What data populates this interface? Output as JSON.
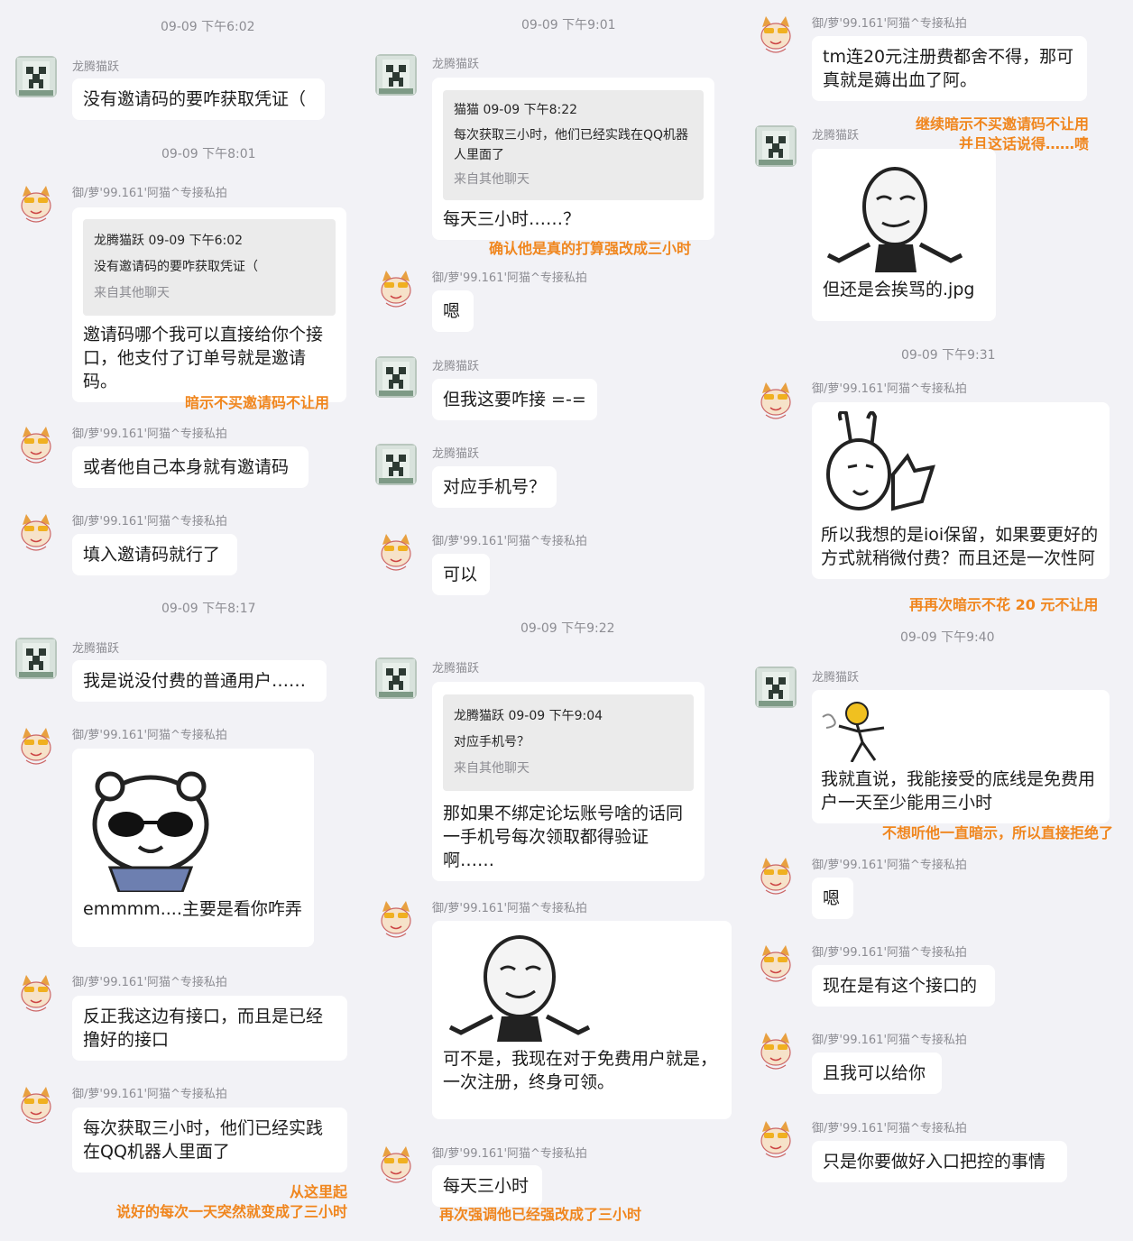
{
  "names": {
    "a": "龙腾猫跃",
    "b": "御/萝'99.161'阿猫^专接私拍"
  },
  "quote_source": "来自其他聊天",
  "col1": {
    "ts1": "09-09 下午6:02",
    "m1": "没有邀请码的要咋获取凭证（",
    "ts2": "09-09 下午8:01",
    "m2_quote_head": "龙腾猫跃 09-09 下午6:02",
    "m2_quote_body": "没有邀请码的要咋获取凭证（",
    "m2": "邀请码哪个我可以直接给你个接口，他支付了订单号就是邀请码。",
    "note1": "暗示不买邀请码不让用",
    "m3": "或者他自己本身就有邀请码",
    "m4": "填入邀请码就行了",
    "ts3": "09-09 下午8:17",
    "m5": "我是说没付费的普通用户……",
    "m6": "emmmm....主要是看你咋弄",
    "m7": "反正我这边有接口，而且是已经撸好的接口",
    "m8": "每次获取三小时，他们已经实践在QQ机器人里面了",
    "note2a": "从这里起",
    "note2b": "说好的每次一天突然就变成了三小时"
  },
  "col2": {
    "ts1": "09-09 下午9:01",
    "q1_head": "猫猫 09-09 下午8:22",
    "q1_body": "每次获取三小时，他们已经实践在QQ机器人里面了",
    "m1": "每天三小时……？",
    "note1": "确认他是真的打算强改成三小时",
    "m2": "嗯",
    "m3": "但我这要咋接 =-=",
    "m4": "对应手机号？",
    "m5": "可以",
    "ts2": "09-09 下午9:22",
    "q2_head": "龙腾猫跃 09-09 下午9:04",
    "q2_body": "对应手机号？",
    "m6": "那如果不绑定论坛账号啥的话同一手机号每次领取都得验证啊……",
    "m7": "可不是，我现在对于免费用户就是，一次注册，终身可领。",
    "m8": "每天三小时",
    "note2": "再次强调他已经强改成了三小时"
  },
  "col3": {
    "m1": "tm连20元注册费都舍不得，那可真就是薅出血了阿。",
    "note1a": "继续暗示不买邀请码不让用",
    "note1b": "并且这话说得……啧",
    "m2": "但还是会挨骂的.jpg",
    "ts1": "09-09 下午9:31",
    "m3": "所以我想的是ioi保留，如果要更好的方式就稍微付费？而且还是一次性阿",
    "note2": "再再次暗示不花 20 元不让用",
    "ts2": "09-09 下午9:40",
    "m4": "我就直说，我能接受的底线是免费用户一天至少能用三小时",
    "note3": "不想听他一直暗示，所以直接拒绝了",
    "m5": "嗯",
    "m6": "现在是有这个接口的",
    "m7": "且我可以给你",
    "m8": "只是你要做好入口把控的事情"
  },
  "colors": {
    "note": "#f0861e",
    "bubble": "#ffffff",
    "bg": "#f2f2f6"
  }
}
